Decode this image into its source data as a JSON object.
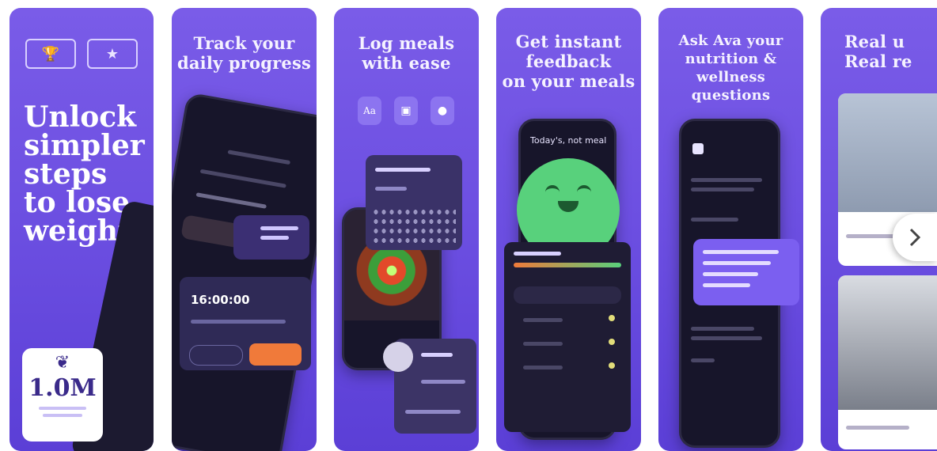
{
  "screens": [
    {
      "badge1": "🏆",
      "badge2": "★",
      "headline": [
        "Unlock",
        "simpler",
        "steps",
        "to lose",
        "weight"
      ],
      "stat": {
        "value": "1.0M"
      }
    },
    {
      "title": [
        "Track your",
        "daily progress"
      ],
      "timer": "16:00:00"
    },
    {
      "title": [
        "Log meals",
        "with ease"
      ]
    },
    {
      "title": [
        "Get instant",
        "feedback",
        "on your meals"
      ],
      "prompt": "Today's, not meal"
    },
    {
      "title": [
        "Ask Ava your",
        "nutrition & wellness",
        "questions"
      ]
    },
    {
      "title": [
        "Real u",
        "Real re"
      ]
    }
  ],
  "colors": {
    "brand": "#6a4de0",
    "accent": "#f07a3a",
    "green": "#58d17c",
    "dark": "#17152a"
  },
  "icons": {
    "next": "chevron-right-icon"
  }
}
